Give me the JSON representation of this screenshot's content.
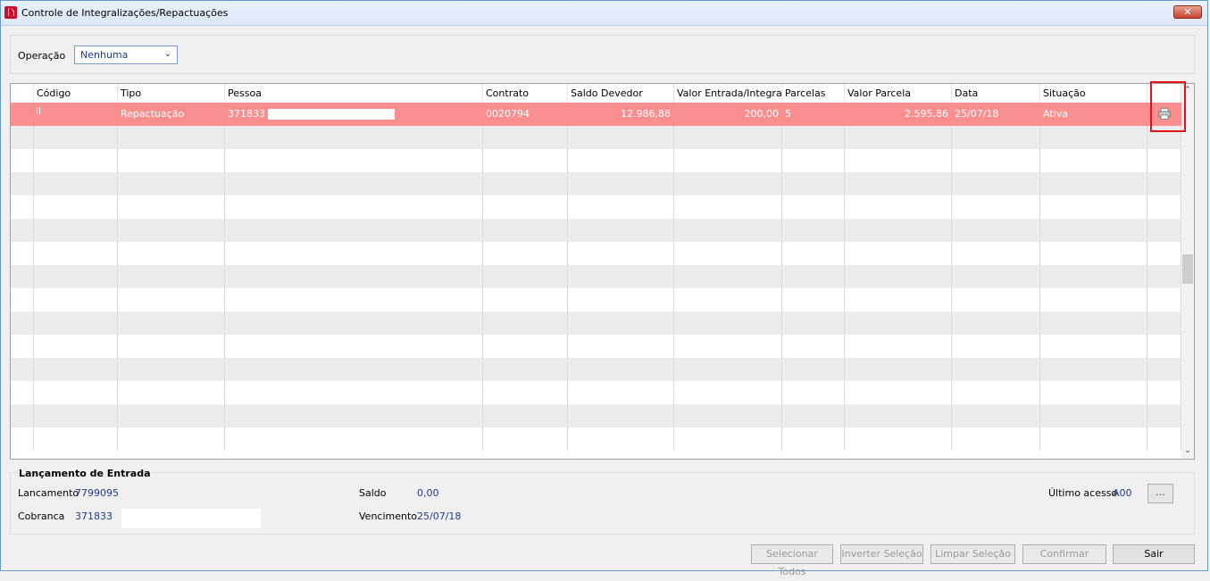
{
  "window": {
    "title": "Controle de Integralizações/Repactuações",
    "close": "✕"
  },
  "operacao": {
    "label": "Operação",
    "value": "Nenhuma"
  },
  "grid": {
    "columns": [
      "Código",
      "Tipo",
      "Pessoa",
      "Contrato",
      "Saldo Devedor",
      "Valor Entrada/Integrali...",
      "Parcelas",
      "Valor Parcela",
      "Data",
      "Situação"
    ],
    "selected_row": {
      "codigo": "",
      "tipo": "Repactuação",
      "pessoa": "371833",
      "contrato": "0020794",
      "saldo_devedor": "12.986,88",
      "valor_entrada": "200,00",
      "parcelas": "5",
      "valor_parcela": "2.595,86",
      "data": "25/07/18",
      "situacao": "Ativa",
      "action_icon": "printer-icon"
    }
  },
  "lancamento": {
    "legend": "Lançamento de Entrada",
    "lancamento_label": "Lancamento",
    "lancamento_value": "7799095",
    "cobranca_label": "Cobranca",
    "cobranca_value": "371833",
    "saldo_label": "Saldo",
    "saldo_value": "0,00",
    "vencimento_label": "Vencimento",
    "vencimento_value": "25/07/18",
    "ultimo_acesso_label": "Último acesso",
    "ultimo_acesso_value": "A00",
    "ellipsis_label": "..."
  },
  "buttons": {
    "selecionar_todos": "Selecionar Todos",
    "inverter_selecao": "Inverter Seleção",
    "limpar_selecao": "Limpar Seleção",
    "confirmar": "Confirmar",
    "sair": "Sair"
  },
  "colors": {
    "selected_row": "#fb8e8e",
    "highlight": "#e0121b",
    "value_text": "#1e3a8a"
  }
}
